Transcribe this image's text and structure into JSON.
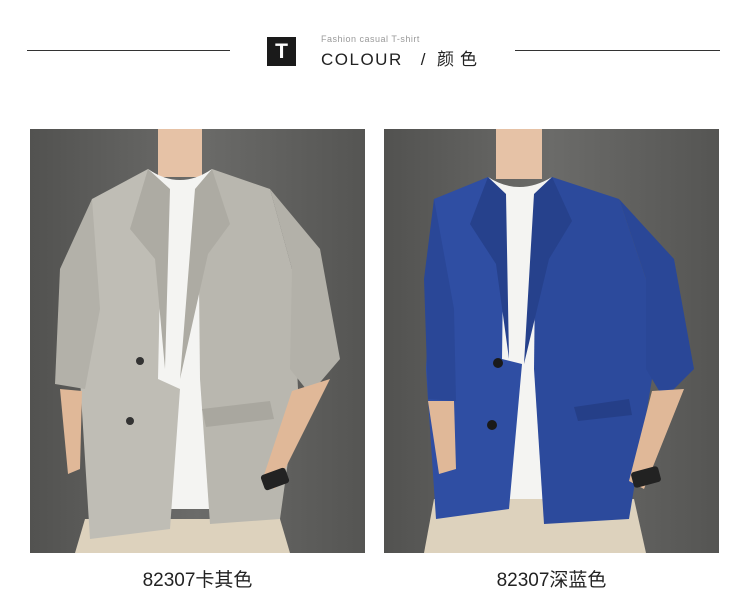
{
  "header": {
    "badge": "T",
    "subtitle": "Fashion casual T-shirt",
    "title_en": "COLOUR",
    "separator": "/",
    "title_cn": "颜色"
  },
  "products": [
    {
      "caption": "82307卡其色",
      "jacket_color": "#bfbdb5"
    },
    {
      "caption": "82307深蓝色",
      "jacket_color": "#2f4ea3"
    }
  ]
}
